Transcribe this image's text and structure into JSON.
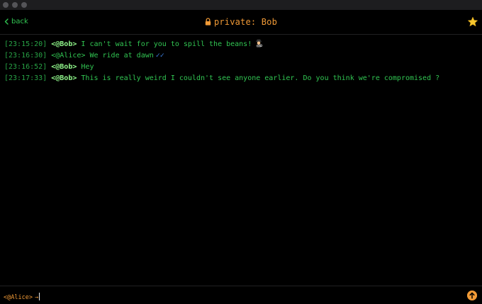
{
  "header": {
    "back_label": "back",
    "title": "private: Bob"
  },
  "messages": [
    {
      "time": "[23:15:20]",
      "nick": "<@Bob>",
      "text": "I can't wait for you to spill the beans!",
      "emoji": "detective-emoji"
    },
    {
      "time": "[23:16:30]",
      "nick": "<@Alice>",
      "text": "We ride at dawn",
      "status": "✓✓"
    },
    {
      "time": "[23:16:52]",
      "nick": "<@Bob>",
      "text": "Hey"
    },
    {
      "time": "[23:17:33]",
      "nick": "<@Bob>",
      "text": "This is really weird I couldn't see anyone earlier. Do you think we're compromised ?"
    }
  ],
  "input": {
    "prompt": "<@Alice>",
    "prompt_arrow": "→",
    "value": "",
    "placeholder": ""
  },
  "colors": {
    "accent": "#f19a36",
    "text": "#31c552",
    "nick": "#8ff58a",
    "read_receipt": "#3a7fe0",
    "background": "#000000"
  },
  "icons": {
    "back": "chevron-left-icon",
    "lock": "lock-icon",
    "favorite": "star-icon",
    "send": "arrow-up-icon"
  }
}
